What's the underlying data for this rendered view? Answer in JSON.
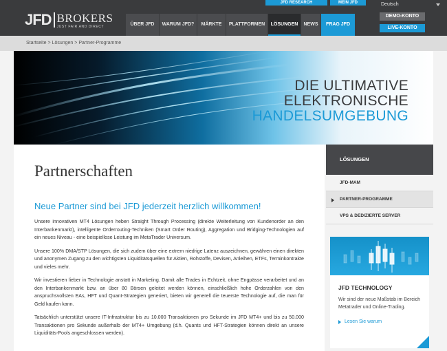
{
  "header": {
    "utility_links": [
      "JFD RESEARCH",
      "MEIN JFD"
    ],
    "language": "Deutsch",
    "logo": {
      "mark": "JFD",
      "word": "BROKERS",
      "tagline": "JUST FAIR AND DIRECT"
    },
    "nav": [
      {
        "label": "ÜBER JFD"
      },
      {
        "label": "WARUM JFD?"
      },
      {
        "label": "MÄRKTE"
      },
      {
        "label": "PLATTFORMEN"
      },
      {
        "label": "LÖSUNGEN"
      },
      {
        "label": "NEWS"
      },
      {
        "label": "FRAG JFD"
      }
    ],
    "active_nav": "LÖSUNGEN",
    "demo_button": "DEMO-KONTO",
    "live_button": "LIVE-KONTO"
  },
  "breadcrumb": {
    "items": [
      "Startseite",
      "Lösungen",
      "Partner-Programme"
    ],
    "separator": ">"
  },
  "hero": {
    "line1": "DIE ULTIMATIVE",
    "line2": "ELEKTRONISCHE",
    "line3": "HANDELSUMGEBUNG"
  },
  "main": {
    "title": "Partnerschaften",
    "subtitle": "Neue Partner sind bei JFD jederzeit herzlich willkommen!",
    "paragraphs": [
      "Unsere innovativen MT4 Lösungen heben Straight Through Processing (direkte Weiterleitung von Kundenorder an den Interbankenmarkt), intelligente Orderrouting-Techniken (Smart Order Routing), Aggregation und Bridging-Technologien auf ein neues Niveau - eine beispiellose Leistung im MetaTrader Universum.",
      "Unsere 100% DMA/STP Lösungen, die sich zudem über eine extrem niedrige Latenz auszeichnen, gewähren einen direkten und anonymen Zugang zu den wichtigsten Liquiditätsquellen für Aktien, Rohstoffe, Devisen, Anleihen, ETFs, Terminkontrakte und vieles mehr.",
      "Wir investieren lieber in Technologie anstatt in Marketing. Damit alle Trades in Echtzeit, ohne Engpässe verarbeitet und an den Interbankenmarkt bzw. an über 80 Börsen geleitet werden können, einschließlich hohe Orderzahlen von den anspruchsvollsten EAs, HFT und Quant-Strategien generiert, bieten wir generell die teuerste Technologie auf, die man für Geld kaufen kann.",
      "Tatsächlich unterstützt unsere IT-Infrastruktur bis zu 10.000 Transaktionen pro Sekunde im JFD MT4+ und bis zu 50.000 Transaktionen pro Sekunde außerhalb der MT4+ Umgebung (d.h. Quants und HFT-Strategien können direkt an unsere Liquiditäts-Pools angeschlossen werden)."
    ]
  },
  "sidebar": {
    "heading": "LÖSUNGEN",
    "items": [
      {
        "label": "JFD-MAM"
      },
      {
        "label": "PARTNER-PROGRAMME"
      },
      {
        "label": "VPS & DEDIZIERTE SERVER"
      }
    ],
    "active_item": "PARTNER-PROGRAMME",
    "promo": {
      "title": "JFD TECHNOLOGY",
      "text": "Wir sind der neue Maßstab im Bereich Metatrader und Online-Trading.",
      "link": "Lesen Sie warum"
    }
  },
  "colors": {
    "accent": "#1c9ad6",
    "header_bg": "#3a3b3d",
    "breadcrumb_bg": "#dcdcdc"
  },
  "icons": [
    "caret-down-icon",
    "arrow-right-icon",
    "candlestick-chart-icon"
  ]
}
